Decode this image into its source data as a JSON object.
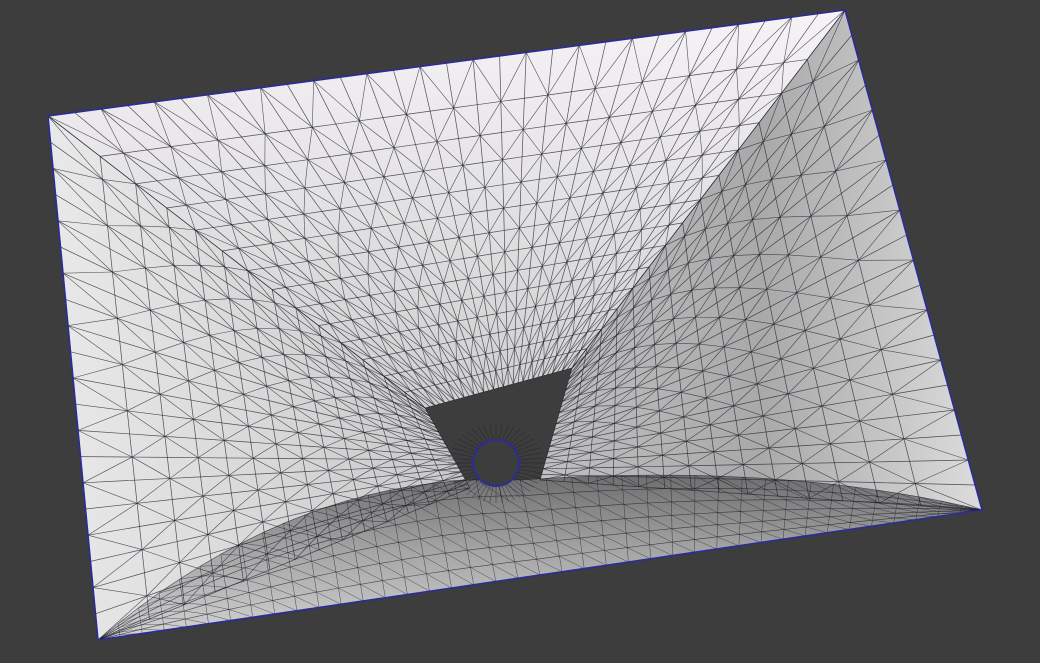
{
  "viewport": {
    "background_color": "#3d3d3d",
    "mesh_fill_light": "#f2f0f2",
    "mesh_fill_mid": "#c4c4c4",
    "mesh_fill_dark": "#8e8e8e",
    "mesh_line_color": "#1c1c2a",
    "outline_color": "#2b2b9a"
  }
}
